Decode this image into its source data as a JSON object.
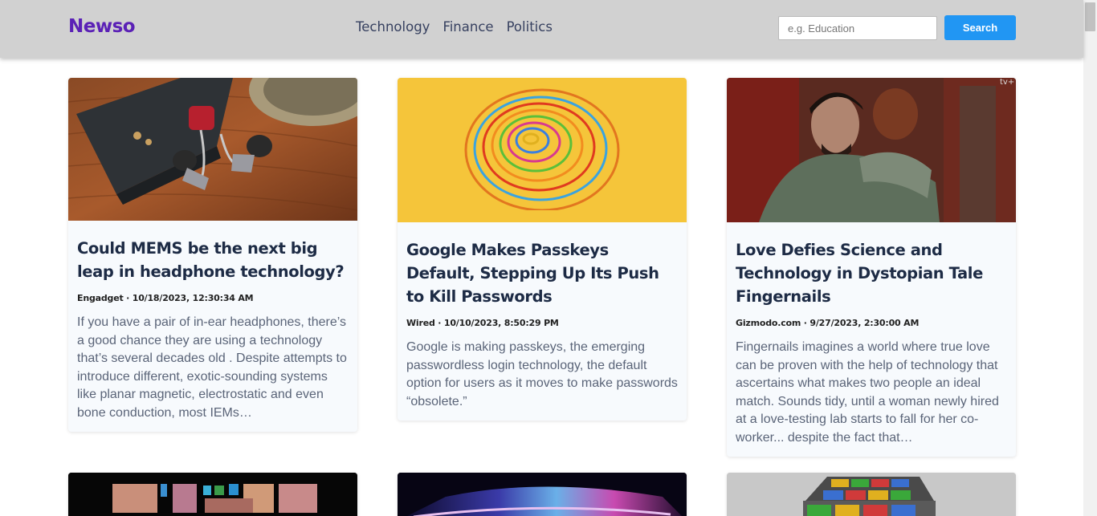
{
  "header": {
    "logo": "Newso",
    "nav": [
      "Technology",
      "Finance",
      "Politics"
    ],
    "search_placeholder": "e.g. Education",
    "search_label": "Search"
  },
  "articles": [
    {
      "title": "Could MEMS be the next big leap in headphone technology?",
      "meta": "Engadget · 10/18/2023, 12:30:34 AM",
      "description": "If you have a pair of in-ear headphones, there’s a good chance they are using a technology that’s several decades old . Despite attempts to introduce different, exotic-sounding systems like planar magnetic, electrostatic and even bone conduction, most IEMs…"
    },
    {
      "title": "Google Makes Passkeys Default, Stepping Up Its Push to Kill Passwords",
      "meta": "Wired · 10/10/2023, 8:50:29 PM",
      "description": "Google is making passkeys, the emerging passwordless login technology, the default option for users as it moves to make passwords “obsolete.”"
    },
    {
      "title": "Love Defies Science and Technology in Dystopian Tale Fingernails",
      "meta": "Gizmodo.com · 9/27/2023, 2:30:00 AM",
      "description": "Fingernails imagines a world where true love can be proven with the help of technology that ascertains what makes two people an ideal match. Sounds tidy, until a woman newly hired at a love-testing lab starts to fall for her co-worker... despite the fact that…"
    }
  ],
  "colors": {
    "header_bg": "#d1d1d1",
    "logo": "#5b21b6",
    "button": "#2196f3"
  }
}
